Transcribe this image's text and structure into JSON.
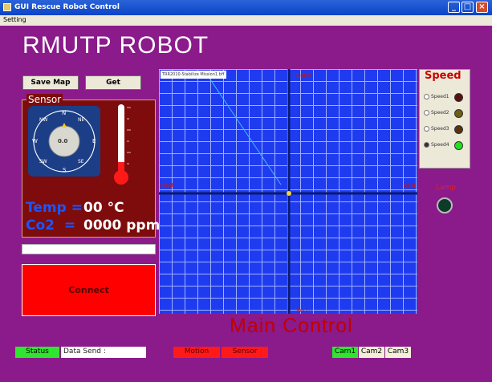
{
  "window": {
    "title": "GUI Rescue Robot Control"
  },
  "menu": {
    "setting": "Setting"
  },
  "app": {
    "title": "RMUTP ROBOT"
  },
  "buttons": {
    "save_map": "Save Map",
    "get": "Get",
    "connect": "Connect"
  },
  "sensor": {
    "label": "Sensor",
    "compass": {
      "n": "N",
      "ne": "NE",
      "e": "E",
      "se": "SE",
      "s": "S",
      "sw": "SW",
      "w": "W",
      "nw": "NW",
      "heading": "0.0"
    },
    "temp": {
      "label": "Temp =",
      "value": "00 °C"
    },
    "co2": {
      "label": "Co2  =",
      "value": "0000 ppm"
    }
  },
  "map": {
    "caption": "TRR2010-Stabilize Mission1.bff",
    "labels": {
      "north": "North",
      "south": "South",
      "west": "West",
      "east": "East"
    },
    "main_control": "Main Control"
  },
  "speed": {
    "title": "Speed",
    "options": [
      "Speed1",
      "Speed2",
      "Speed3",
      "Speed4"
    ],
    "selected": "Speed4",
    "led_colors": [
      "#5a1010",
      "#6b6010",
      "#5a3210",
      "#22e022"
    ]
  },
  "lamp": {
    "label": "Lamp"
  },
  "statusbar": {
    "status": "Status",
    "data_send": "Data Send :",
    "motion": "Motion",
    "sensor": "Sensor",
    "cams": [
      "Cam1",
      "Cam2",
      "Cam3"
    ]
  },
  "colors": {
    "background": "#8b1a8b",
    "grid": "#1f3bf0",
    "active_green": "#2ee62e",
    "alert_red": "#ff1a1a"
  }
}
